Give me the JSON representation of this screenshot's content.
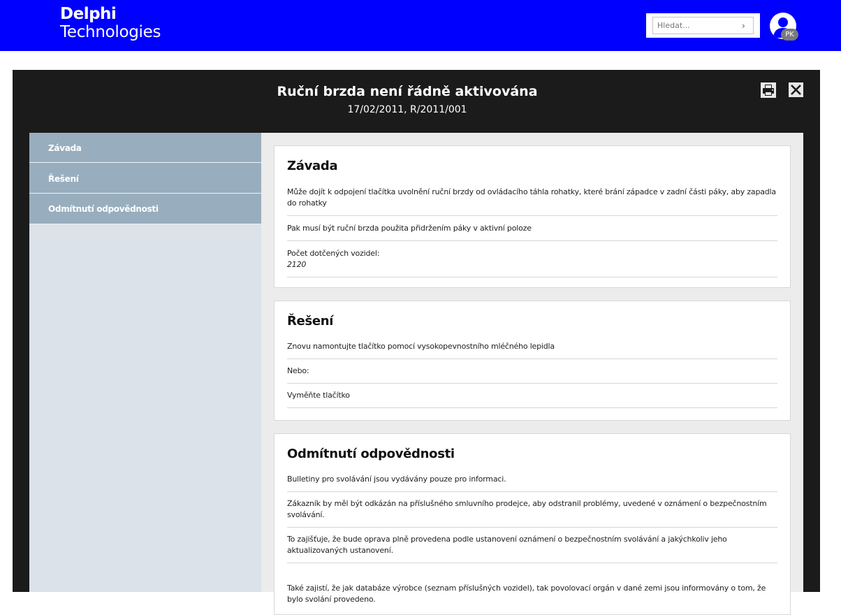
{
  "header": {
    "logo_line1": "Delphi",
    "logo_line2": "Technologies",
    "search_placeholder": "Hledat...",
    "search_button": "›",
    "user_initials": "PK",
    "colors": {
      "brand_blue": "#0000ff"
    }
  },
  "modal": {
    "title": "Ruční brzda není řádně aktivována",
    "subtitle": "17/02/2011, R/2011/001",
    "print_icon": "printer-icon",
    "close_icon": "close-icon"
  },
  "sidebar": {
    "items": [
      {
        "label": "Závada"
      },
      {
        "label": "Řešení"
      },
      {
        "label": "Odmítnutí odpovědnosti"
      }
    ]
  },
  "sections": {
    "zavada": {
      "title": "Závada",
      "rows": [
        "Může dojít k odpojení tlačítka uvolnění ruční brzdy od ovládacího táhla rohatky, které brání západce v zadní části páky, aby zapadla do rohatky",
        "Pak musí být ruční brzda použita přidržením páky v aktivní poloze"
      ],
      "vehicles_label": "Počet dotčených vozidel:",
      "vehicles_value": "2120"
    },
    "reseni": {
      "title": "Řešení",
      "rows": [
        "Znovu namontujte tlačítko pomocí vysokopevnostního mléčného lepidla",
        "Nebo:",
        "Vyměňte tlačítko"
      ]
    },
    "odmitnuti": {
      "title": "Odmítnutí odpovědnosti",
      "rows": [
        "Bulletiny pro svolávání jsou vydávány pouze pro informaci.",
        "Zákazník by měl být odkázán na příslušného smluvního prodejce, aby odstranil problémy, uvedené v oznámení o bezpečnostním svolávání.",
        "To zajišťuje, že bude oprava plně provedena podle ustanovení oznámení o bezpečnostním svolávání a jakýchkoliv jeho aktualizovaných ustanovení.",
        "Také zajistí, že jak databáze výrobce (seznam příslušných vozidel), tak povolovací orgán v dané zemi jsou informovány o tom, že bylo svolání provedeno."
      ]
    }
  }
}
